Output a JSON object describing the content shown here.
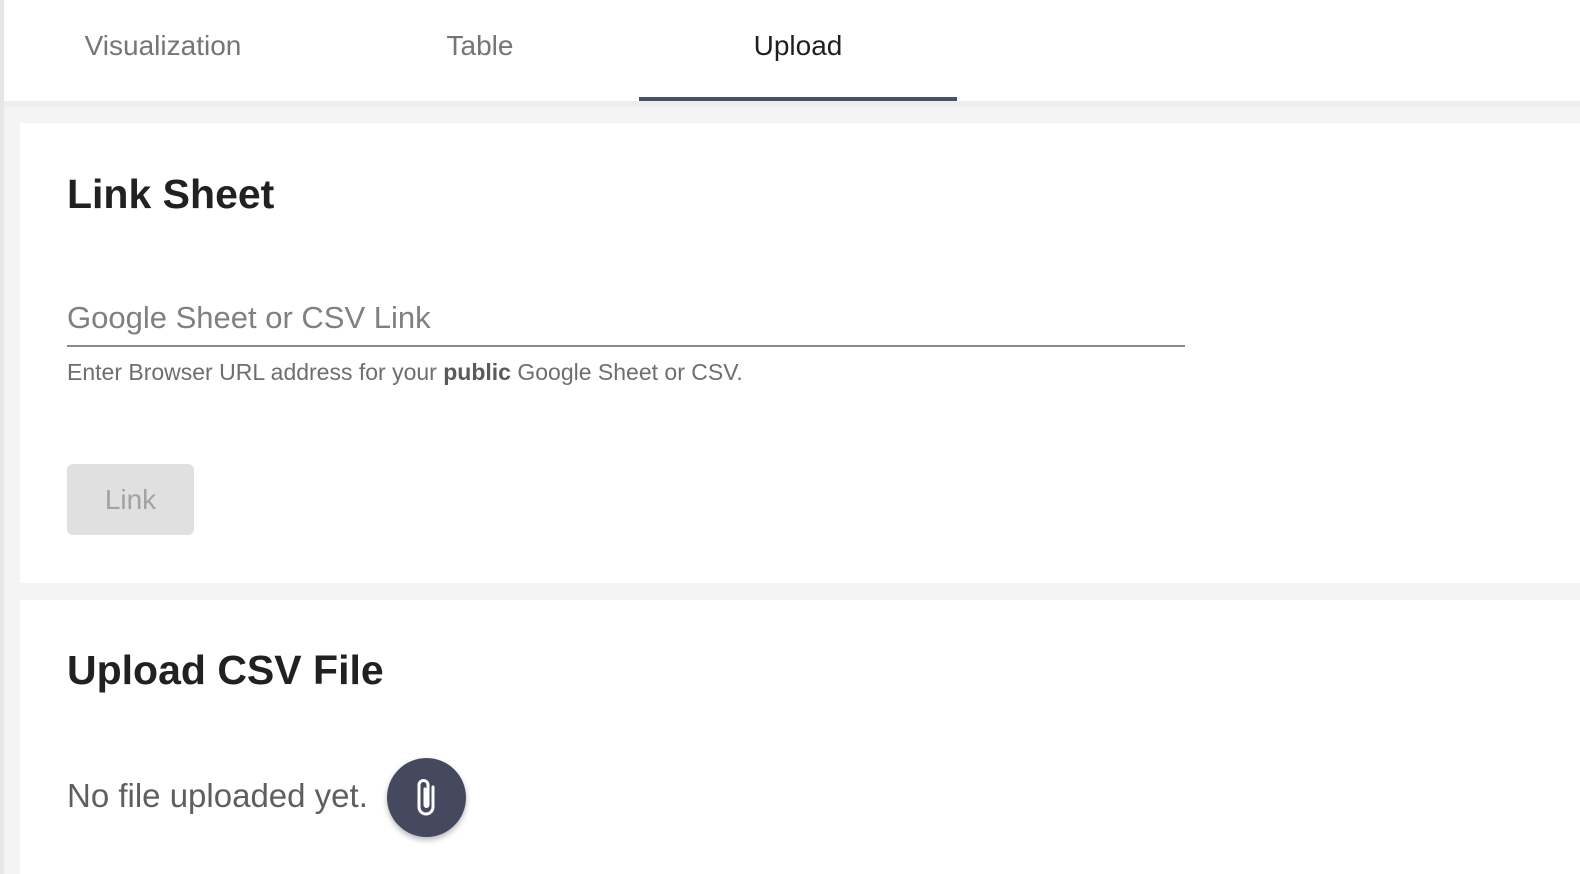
{
  "tabs": [
    {
      "label": "Visualization"
    },
    {
      "label": "Table"
    },
    {
      "label": "Upload"
    }
  ],
  "active_tab": "Upload",
  "link_sheet": {
    "title": "Link Sheet",
    "input_placeholder": "Google Sheet or CSV Link",
    "input_value": "",
    "helper_prefix": "Enter Browser URL address for your ",
    "helper_bold": "public",
    "helper_suffix": " Google Sheet or CSV.",
    "button_label": "Link"
  },
  "upload_csv": {
    "title": "Upload CSV File",
    "status_text": "No file uploaded yet.",
    "attach_icon": "paperclip-icon"
  },
  "colors": {
    "accent": "#44495f",
    "tab_indicator": "#4a5068"
  }
}
